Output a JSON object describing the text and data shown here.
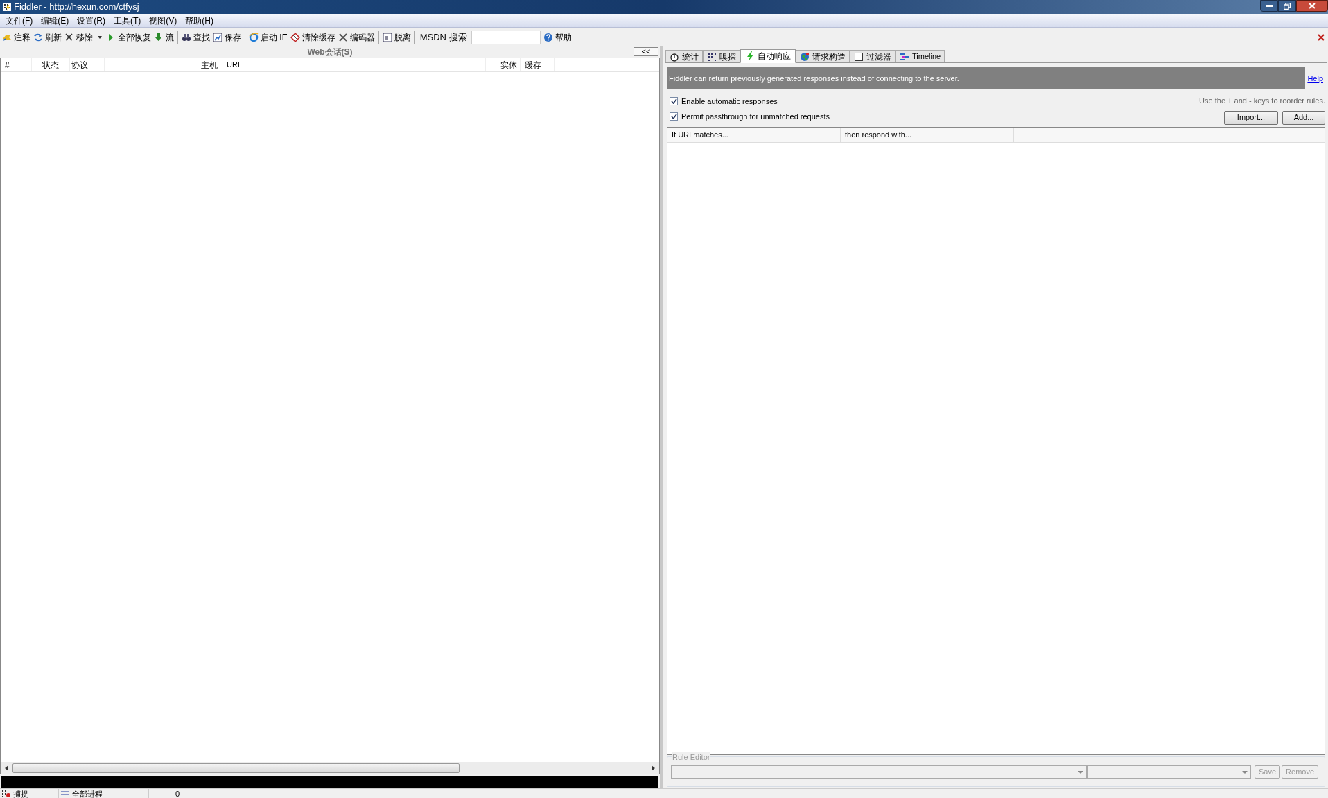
{
  "window": {
    "title": "Fiddler - http://hexun.com/ctfysj"
  },
  "menu": [
    "文件(F)",
    "编辑(E)",
    "设置(R)",
    "工具(T)",
    "视图(V)",
    "帮助(H)"
  ],
  "toolbar": [
    {
      "kind": "button",
      "label": "注释"
    },
    {
      "kind": "button",
      "label": "刷新"
    },
    {
      "kind": "dropdown",
      "label": "移除"
    },
    {
      "kind": "button",
      "label": "全部恢复"
    },
    {
      "kind": "button",
      "label": "流"
    },
    {
      "kind": "separator"
    },
    {
      "kind": "button",
      "label": "查找"
    },
    {
      "kind": "button",
      "label": "保存"
    },
    {
      "kind": "separator"
    },
    {
      "kind": "button",
      "label": "启动 IE"
    },
    {
      "kind": "button",
      "label": "清除缓存"
    },
    {
      "kind": "button",
      "label": "编码器"
    },
    {
      "kind": "separator"
    },
    {
      "kind": "button",
      "label": "脱离"
    },
    {
      "kind": "separator"
    },
    {
      "kind": "label",
      "label": "MSDN 搜索"
    },
    {
      "kind": "field"
    },
    {
      "kind": "button",
      "label": "帮助"
    }
  ],
  "sessions": {
    "title": "Web会话(S)",
    "collapse": "<<",
    "columns": [
      "#",
      "状态",
      "协议",
      "主机",
      "URL",
      "实体",
      "缓存"
    ]
  },
  "tabs": [
    {
      "label": "统计",
      "selected": false
    },
    {
      "label": "嗅探",
      "selected": false
    },
    {
      "label": "自动响应",
      "selected": true
    },
    {
      "label": "请求构造",
      "selected": false
    },
    {
      "label": "过滤器",
      "selected": false
    },
    {
      "label": "Timeline",
      "selected": false
    }
  ],
  "autoresponder": {
    "banner": "Fiddler can return previously generated responses instead of connecting to the server.",
    "help": "Help",
    "options": [
      {
        "label": "Enable automatic responses",
        "checked": true
      },
      {
        "label": "Permit passthrough for unmatched requests",
        "checked": true
      }
    ],
    "hint": "Use the + and - keys to reorder rules.",
    "buttons": [
      "Import...",
      "Add..."
    ],
    "columns": [
      "If URI matches...",
      "then respond with..."
    ],
    "rule_editor": {
      "title": "Rule Editor",
      "buttons": [
        "Save",
        "Remove"
      ]
    }
  },
  "status_bar": [
    "捕捉",
    "全部进程",
    "0"
  ]
}
